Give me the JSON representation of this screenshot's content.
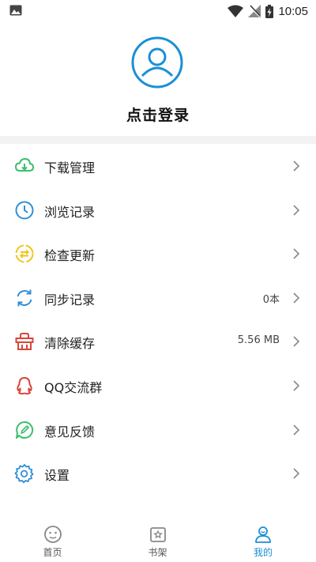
{
  "status_bar": {
    "time": "10:05"
  },
  "profile": {
    "login_text": "点击登录"
  },
  "menu": [
    {
      "label": "下载管理",
      "value": "",
      "icon": "download-cloud-icon",
      "color": "#3bbf6e"
    },
    {
      "label": "浏览记录",
      "value": "",
      "icon": "clock-icon",
      "color": "#2f8fd6"
    },
    {
      "label": "检查更新",
      "value": "",
      "icon": "update-icon",
      "color": "#f2c31b"
    },
    {
      "label": "同步记录",
      "value": "0本",
      "icon": "sync-icon",
      "color": "#2f8fd6"
    },
    {
      "label": "清除缓存",
      "value": "5.56 MB",
      "icon": "clear-cache-icon",
      "color": "#d9453a"
    },
    {
      "label": "QQ交流群",
      "value": "",
      "icon": "qq-icon",
      "color": "#d9453a"
    },
    {
      "label": "意见反馈",
      "value": "",
      "icon": "feedback-icon",
      "color": "#3bbf6e"
    },
    {
      "label": "设置",
      "value": "",
      "icon": "settings-icon",
      "color": "#2f8fd6"
    }
  ],
  "tabs": [
    {
      "label": "首页",
      "icon": "home-face-icon",
      "active": false
    },
    {
      "label": "书架",
      "icon": "bookshelf-icon",
      "active": false
    },
    {
      "label": "我的",
      "icon": "profile-icon",
      "active": true
    }
  ],
  "colors": {
    "accent": "#1a8fd6",
    "band": "#f2f2f2"
  }
}
